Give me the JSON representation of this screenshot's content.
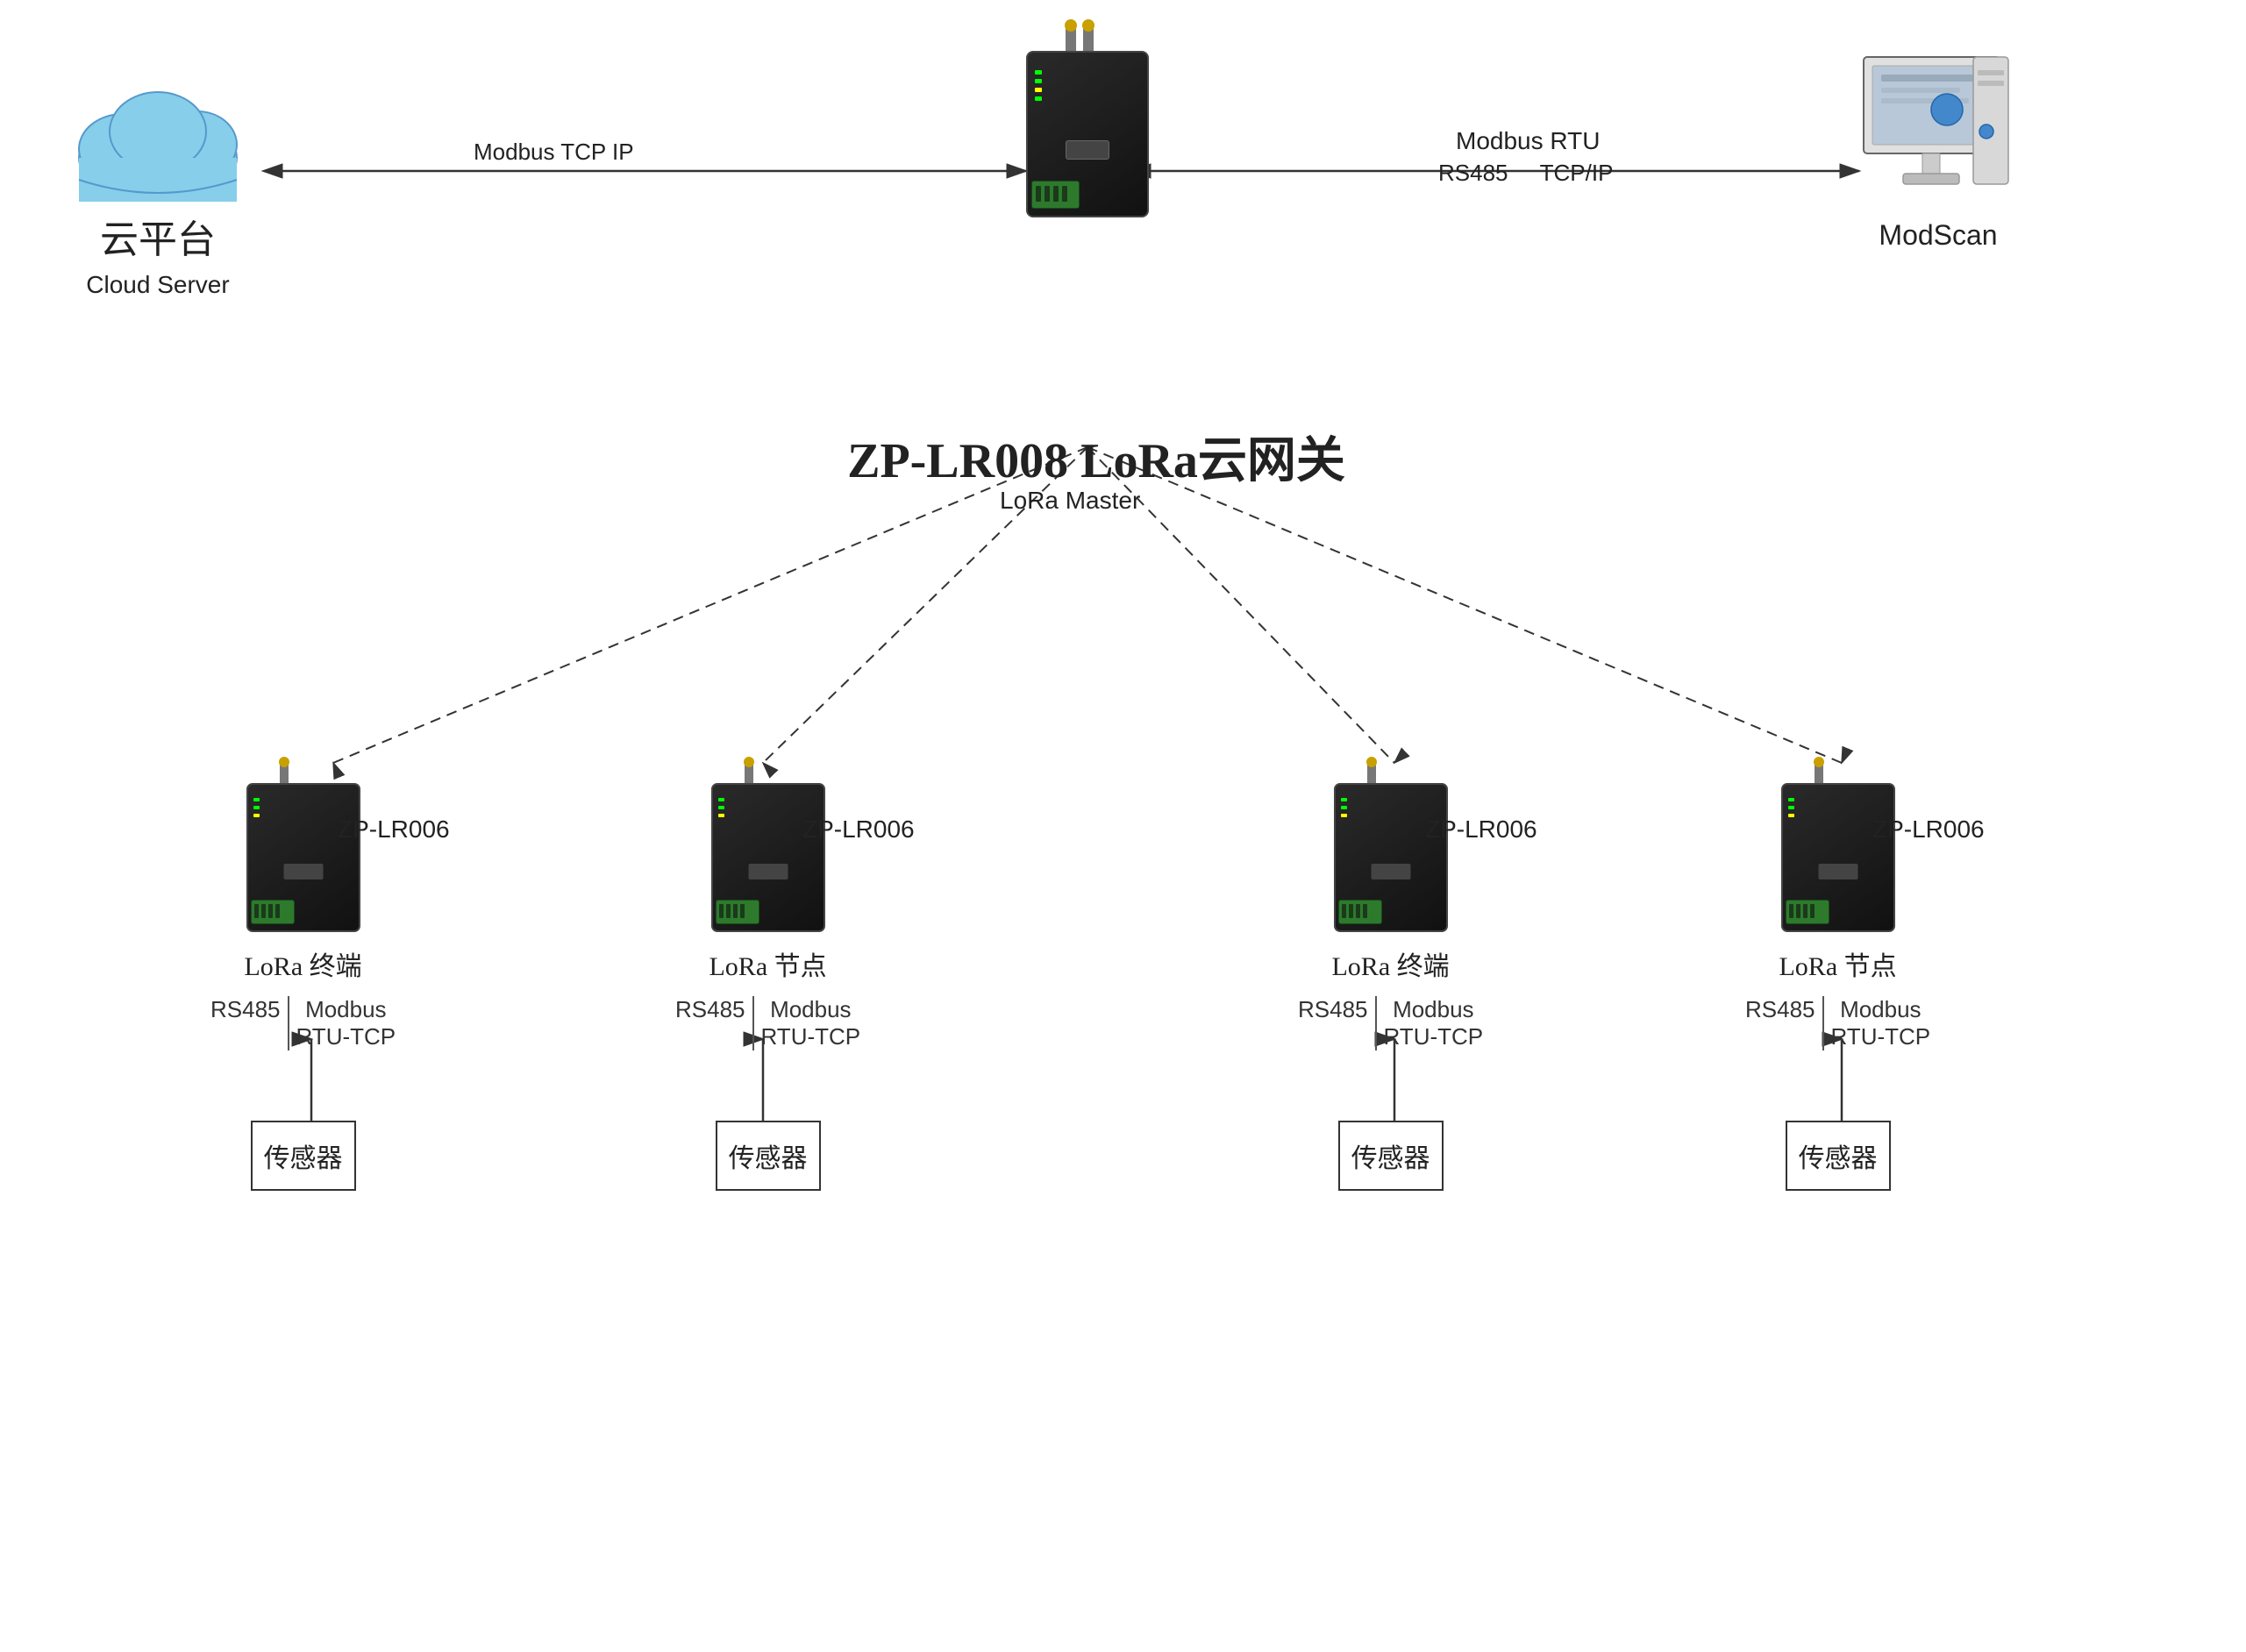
{
  "title": "ZP-LR008 LoRa云网关",
  "cloud": {
    "label_cn": "云平台",
    "label_en": "Cloud Server"
  },
  "modscan": {
    "label": "ModScan"
  },
  "gateway": {
    "model": "ZP-LR008",
    "label": "ZP-LR008 LoRa云网关"
  },
  "connections": {
    "left_label1": "Modbus TCP IP",
    "right_label1": "Modbus RTU",
    "right_label2": "RS485",
    "right_label3": "TCP/IP"
  },
  "lora_master_label": "LoRa Master",
  "nodes": [
    {
      "model": "ZP-LR006",
      "type_label": "LoRa 终端",
      "rs_label": "RS485",
      "modbus_label": "Modbus",
      "rtu_label": "RTU-TCP",
      "sensor_label": "传感器"
    },
    {
      "model": "ZP-LR006",
      "type_label": "LoRa 节点",
      "rs_label": "RS485",
      "modbus_label": "Modbus",
      "rtu_label": "RTU-TCP",
      "sensor_label": "传感器"
    },
    {
      "model": "ZP-LR006",
      "type_label": "LoRa 终端",
      "rs_label": "RS485",
      "modbus_label": "Modbus",
      "rtu_label": "RTU-TCP",
      "sensor_label": "传感器"
    },
    {
      "model": "ZP-LR006",
      "type_label": "LoRa 节点",
      "rs_label": "RS485",
      "modbus_label": "Modbus",
      "rtu_label": "RTU-TCP",
      "sensor_label": "传感器"
    }
  ]
}
